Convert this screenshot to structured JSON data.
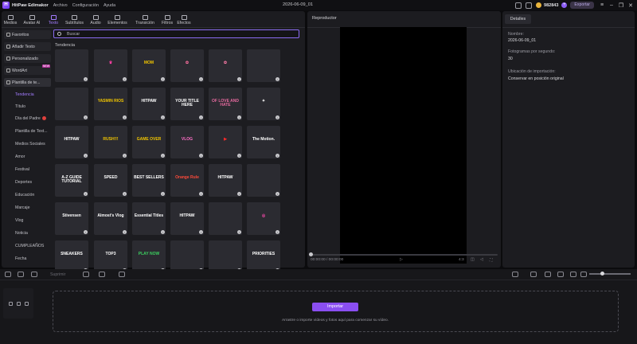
{
  "titlebar": {
    "app_name": "HitPaw Edimakor",
    "menus": [
      "Archivo",
      "Configuración",
      "Ayuda"
    ],
    "project_name": "2026-06-09_01",
    "coins": "982843",
    "export_label": "Exportar"
  },
  "tabs": [
    {
      "label": "Medios",
      "active": false
    },
    {
      "label": "Avatar AI",
      "active": false
    },
    {
      "label": "Texto",
      "active": true
    },
    {
      "label": "Subtítulos",
      "active": false
    },
    {
      "label": "Audio",
      "active": false
    },
    {
      "label": "Elementos",
      "active": false
    },
    {
      "label": "Transición",
      "active": false
    },
    {
      "label": "Filtros",
      "active": false
    },
    {
      "label": "Efectos",
      "active": false
    }
  ],
  "sidebar": {
    "items": [
      {
        "label": "Favoritos"
      },
      {
        "label": "Añadir Texto"
      },
      {
        "label": "Personalizado"
      },
      {
        "label": "WordArt",
        "badge": "NEW"
      },
      {
        "label": "Plantilla de te..."
      }
    ],
    "subitems": [
      {
        "label": "Tendencia",
        "active": true
      },
      {
        "label": "Título"
      },
      {
        "label": "Día del Padre",
        "badge": true
      },
      {
        "label": "Plantilla de Text..."
      },
      {
        "label": "Medios Sociales"
      },
      {
        "label": "Amor"
      },
      {
        "label": "Festival"
      },
      {
        "label": "Deportes"
      },
      {
        "label": "Educación"
      },
      {
        "label": "Marcaje"
      },
      {
        "label": "Vlog"
      },
      {
        "label": "Noticia"
      },
      {
        "label": "CUMPLEAÑOS"
      },
      {
        "label": "Fecha"
      }
    ]
  },
  "search": {
    "placeholder": "Buscar"
  },
  "section_title": "Tendencia",
  "templates": [
    {
      "text": "",
      "color": "#2b2b31",
      "fg": "#ffffff"
    },
    {
      "text": "♛",
      "color": "#2b2b31",
      "fg": "#ff3fa4"
    },
    {
      "text": "MOM",
      "color": "#2b2b31",
      "fg": "#f0c400"
    },
    {
      "text": "✿",
      "color": "#2b2b31",
      "fg": "#ff6fa0"
    },
    {
      "text": "✿",
      "color": "#2b2b31",
      "fg": "#ff7aa8"
    },
    {
      "text": "",
      "color": "#2b2b31",
      "fg": "#9ad66a"
    },
    {
      "text": "",
      "color": "#2b2b31",
      "fg": "#f0c400"
    },
    {
      "text": "YASMIN RIOS",
      "color": "#2b2b31",
      "fg": "#f0c400"
    },
    {
      "text": "HITPAW",
      "color": "#2b2b31",
      "fg": "#ffffff"
    },
    {
      "text": "YOUR TITLE HERE",
      "color": "#2b2b31",
      "fg": "#ffffff"
    },
    {
      "text": "OF LOVE AND HATE",
      "color": "#2b2b31",
      "fg": "#e86aa0"
    },
    {
      "text": "✦",
      "color": "#2b2b31",
      "fg": "#ffffff"
    },
    {
      "text": "HITPAW",
      "color": "#2b2b31",
      "fg": "#ffffff"
    },
    {
      "text": "RUSH!!!",
      "color": "#2b2b31",
      "fg": "#f0c400"
    },
    {
      "text": "GAME OVER",
      "color": "#2b2b31",
      "fg": "#f0c400"
    },
    {
      "text": "VLOG",
      "color": "#2b2b31",
      "fg": "#ff6fc8"
    },
    {
      "text": "▶",
      "color": "#2b2b31",
      "fg": "#ff2a2a"
    },
    {
      "text": "The Motion.",
      "color": "#2b2b31",
      "fg": "#ffffff"
    },
    {
      "text": "A-Z GUIDE TUTORIAL",
      "color": "#2b2b31",
      "fg": "#ffffff"
    },
    {
      "text": "SPEED",
      "color": "#2b2b31",
      "fg": "#ffffff"
    },
    {
      "text": "BEST SELLERS",
      "color": "#2b2b31",
      "fg": "#ffffff"
    },
    {
      "text": "Orange Rule",
      "color": "#2b2b31",
      "fg": "#ff4a3a"
    },
    {
      "text": "HITPAW",
      "color": "#2b2b31",
      "fg": "#ffffff"
    },
    {
      "text": "",
      "color": "#2b2b31",
      "fg": "#ffffff"
    },
    {
      "text": "Stivensen",
      "color": "#2b2b31",
      "fg": "#ffffff"
    },
    {
      "text": "Almost's Vlog",
      "color": "#2b2b31",
      "fg": "#ffffff"
    },
    {
      "text": "Essential Titles",
      "color": "#2b2b31",
      "fg": "#ffffff"
    },
    {
      "text": "HITPAW",
      "color": "#2b2b31",
      "fg": "#ffffff"
    },
    {
      "text": "",
      "color": "#2b2b31",
      "fg": "#4a6aff"
    },
    {
      "text": "◎",
      "color": "#2b2b31",
      "fg": "#ff4ab0"
    },
    {
      "text": "SNEAKERS",
      "color": "#2b2b31",
      "fg": "#ffffff"
    },
    {
      "text": "TOP3",
      "color": "#2b2b31",
      "fg": "#ffffff"
    },
    {
      "text": "PLAY NOW",
      "color": "#2b2b31",
      "fg": "#3cd060"
    },
    {
      "text": "",
      "color": "#2b2b31",
      "fg": "#ffffff"
    },
    {
      "text": "",
      "color": "#2b2b31",
      "fg": "#4a6aff"
    },
    {
      "text": "PRIORITIES",
      "color": "#2b2b31",
      "fg": "#ffffff"
    }
  ],
  "player": {
    "title": "Reproductor",
    "timecode": "00:00:00 / 00:00:00",
    "ratio": "4:3"
  },
  "details": {
    "tab": "Detalles",
    "fields": [
      {
        "label": "Nombre:",
        "value": "2026-06-09_01"
      },
      {
        "label": "Fotogramas por segundo:",
        "value": "30"
      },
      {
        "label": "Ubicación de importación:",
        "value": "Conservar en posición original"
      }
    ]
  },
  "timeline": {
    "split_label": "Suprimir",
    "import_label": "Importar",
    "hint": "Arrastre o importe vídeos y fotos aquí para comenzar su vídeo."
  },
  "accent": "#8a4ef0"
}
